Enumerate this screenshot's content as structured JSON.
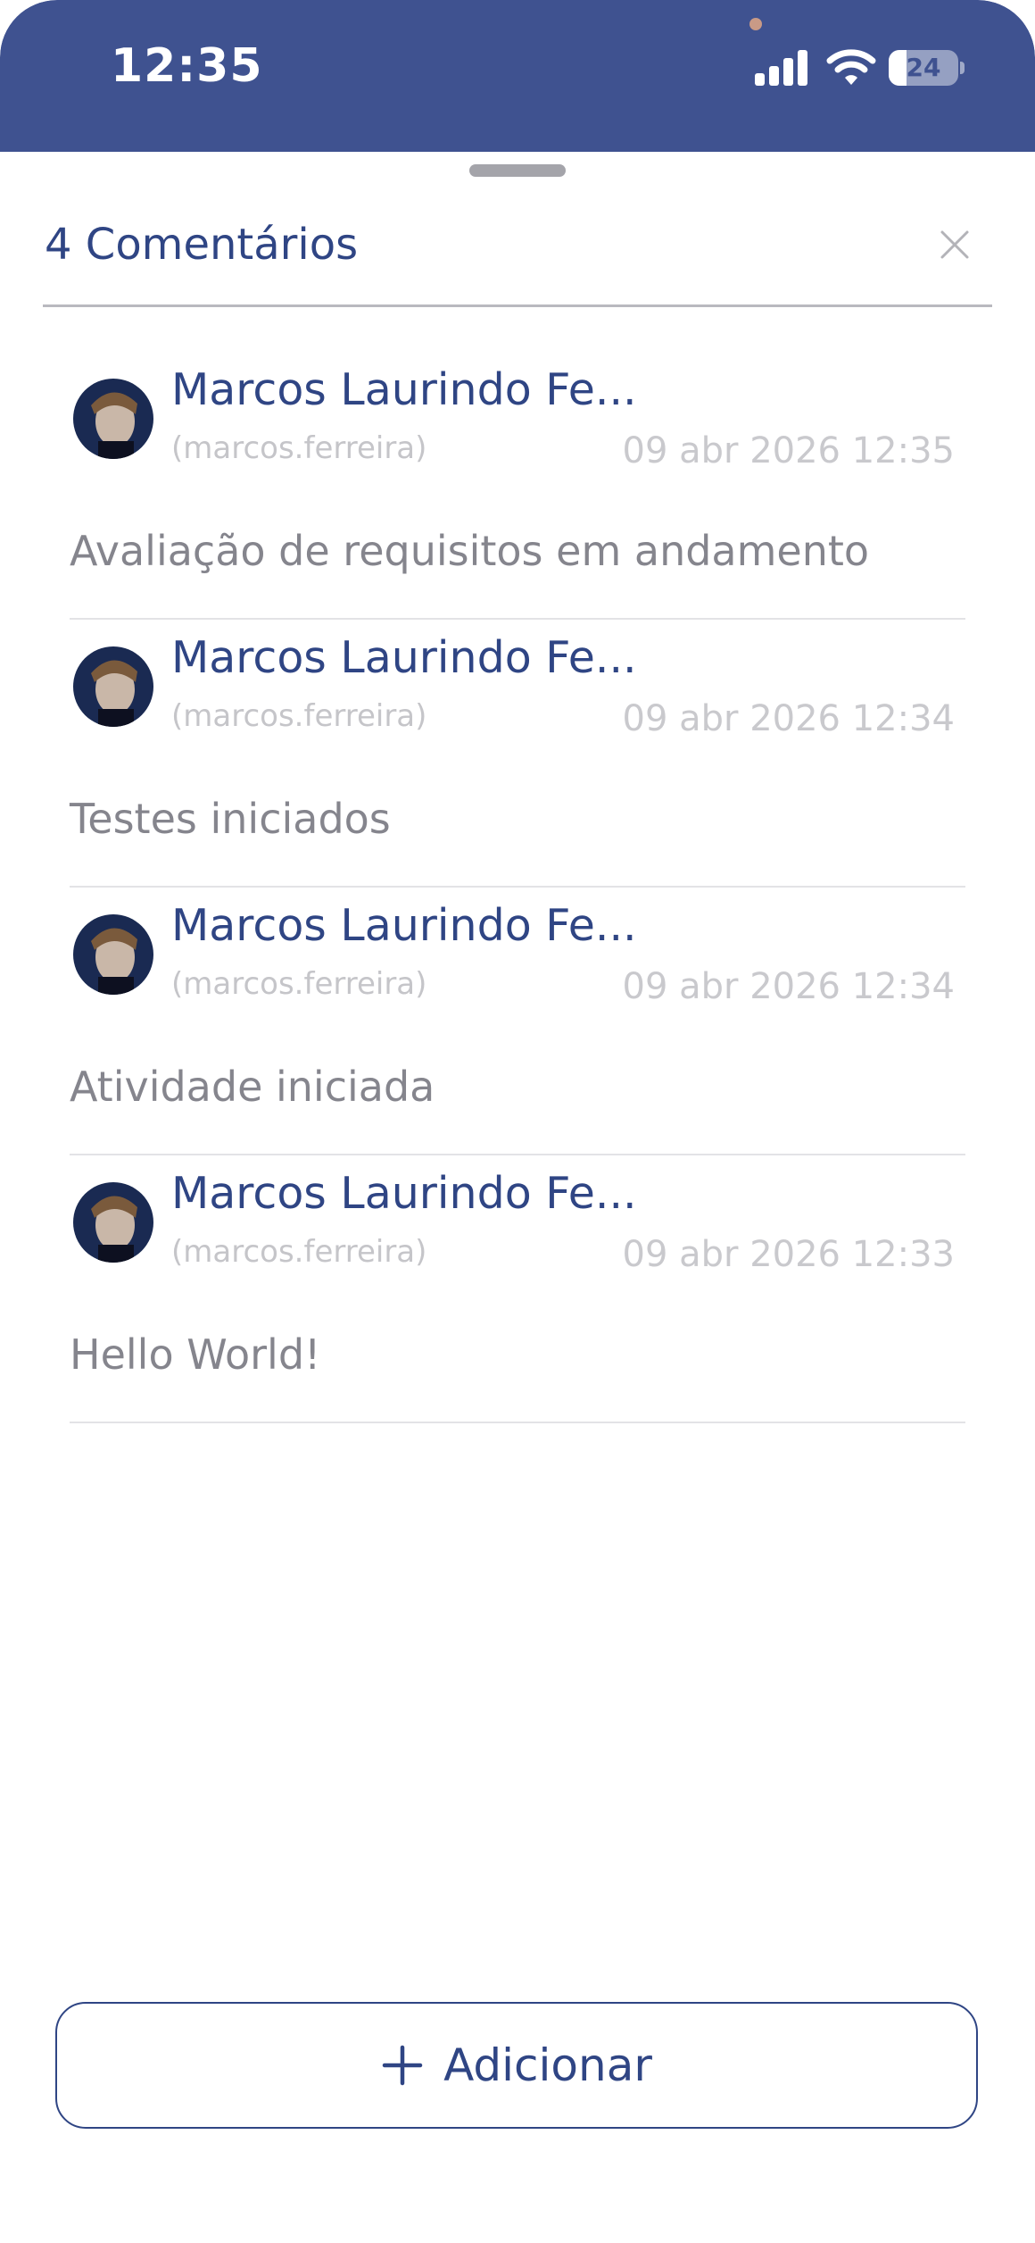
{
  "status_bar": {
    "time": "12:35",
    "battery_level": "24",
    "signal_icon": "cellular-signal-icon",
    "wifi_icon": "wifi-icon",
    "battery_icon": "battery-icon",
    "background_color": "#3f5290"
  },
  "sheet": {
    "title": "4 Comentários",
    "close_icon": "close-icon",
    "accent_color": "#2f4584"
  },
  "comments": [
    {
      "author": "Marcos Laurindo Fe...",
      "handle": "(marcos.ferreira)",
      "date": "09 abr 2026 12:35",
      "text": "Avaliação de requisitos em andamento"
    },
    {
      "author": "Marcos Laurindo Fe...",
      "handle": "(marcos.ferreira)",
      "date": "09 abr 2026 12:34",
      "text": "Testes iniciados"
    },
    {
      "author": "Marcos Laurindo Fe...",
      "handle": "(marcos.ferreira)",
      "date": "09 abr 2026 12:34",
      "text": "Atividade iniciada"
    },
    {
      "author": "Marcos Laurindo Fe...",
      "handle": "(marcos.ferreira)",
      "date": "09 abr 2026 12:33",
      "text": "Hello World!"
    }
  ],
  "add_button": {
    "label": "Adicionar",
    "icon": "plus-icon"
  }
}
